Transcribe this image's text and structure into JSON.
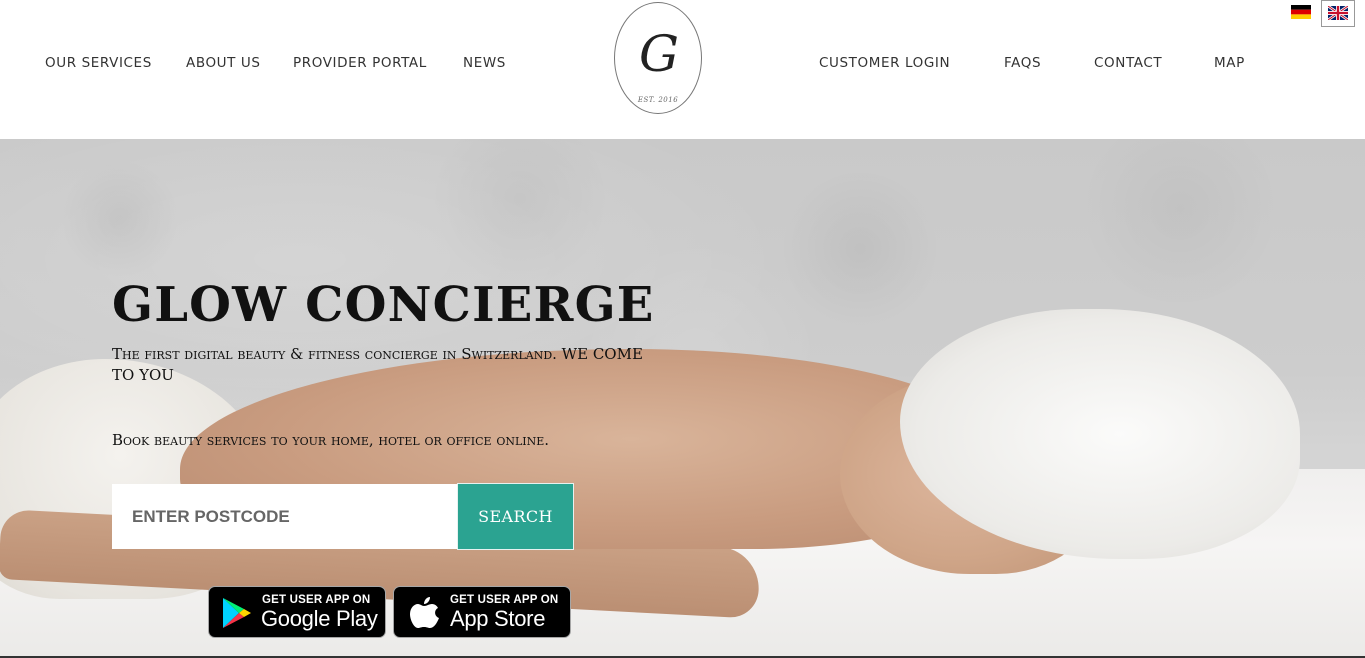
{
  "nav_left": [
    {
      "label": "OUR SERVICES"
    },
    {
      "label": "ABOUT US"
    },
    {
      "label": "PROVIDER PORTAL"
    },
    {
      "label": "NEWS"
    }
  ],
  "nav_right": [
    {
      "label": "CUSTOMER LOGIN"
    },
    {
      "label": "FAQS"
    },
    {
      "label": "CONTACT"
    },
    {
      "label": "MAP"
    }
  ],
  "logo": {
    "letter": "G",
    "est": "EST. 2016"
  },
  "languages": [
    {
      "code": "de",
      "icon": "german-flag-icon"
    },
    {
      "code": "en",
      "icon": "uk-flag-icon",
      "selected": true
    }
  ],
  "hero": {
    "title": "GLOW CONCIERGE",
    "subtitle": "The first digital beauty & fitness concierge in Switzerland. WE COME TO YOU",
    "book_text": "Book beauty services to your home, hotel or office online."
  },
  "search": {
    "placeholder": "ENTER POSTCODE",
    "button_label": "SEARCH"
  },
  "badges": {
    "google": {
      "small": "GET USER APP ON",
      "big": "Google Play",
      "icon": "google-play-icon"
    },
    "apple": {
      "small": "GET USER APP ON",
      "big": "App Store",
      "icon": "apple-icon"
    }
  },
  "colors": {
    "accent": "#2ba391"
  }
}
